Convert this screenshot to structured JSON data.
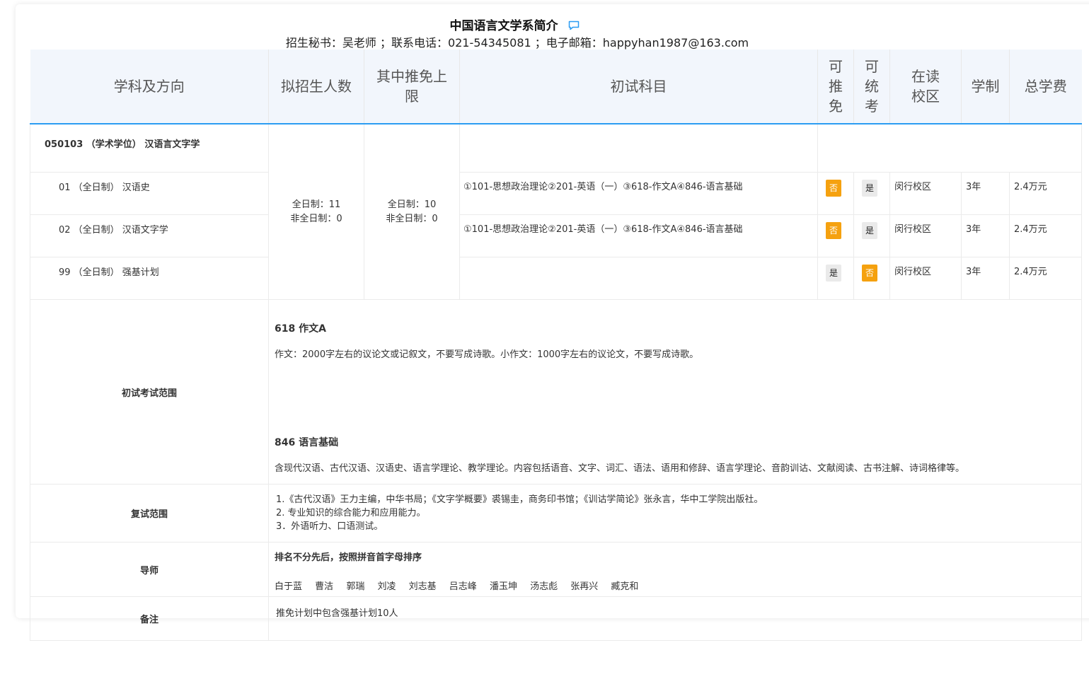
{
  "header": {
    "title": "中国语言文学系简介",
    "contact": "招生秘书：吴老师 ；联系电话：021-54345081 ；电子邮箱：happyhan1987@163.com"
  },
  "columns": [
    "学科及方向",
    "拟招生人数",
    "其中推免上限",
    "初试科目",
    "可推免",
    "可统考",
    "在读校区",
    "学制",
    "总学费"
  ],
  "program": {
    "name": "050103 （学术学位） 汉语言文字学",
    "enroll": "全日制：11 非全日制：0",
    "enroll_full": "全日制：11",
    "enroll_part": "非全日制：0",
    "exempt_full": "全日制：10",
    "exempt_part": "非全日制：0",
    "directions": [
      {
        "name": "01 （全日制） 汉语史",
        "subjects": "①101-思想政治理论②201-英语（一）③618-作文A④846-语言基础",
        "recommend": "否",
        "unified": "是",
        "campus": "闵行校区",
        "duration": "3年",
        "fee": "2.4万元"
      },
      {
        "name": "02 （全日制） 汉语文字学",
        "subjects": "①101-思想政治理论②201-英语（一）③618-作文A④846-语言基础",
        "recommend": "否",
        "unified": "是",
        "campus": "闵行校区",
        "duration": "3年",
        "fee": "2.4万元"
      },
      {
        "name": "99 （全日制） 强基计划",
        "subjects": "",
        "recommend": "是",
        "unified": "否",
        "campus": "闵行校区",
        "duration": "3年",
        "fee": "2.4万元"
      }
    ]
  },
  "exam_scope": {
    "label": "初试考试范围",
    "items": [
      {
        "title": "618 作文A",
        "desc": "作文：2000字左右的议论文或记叙文，不要写成诗歌。小作文：1000字左右的议论文，不要写成诗歌。"
      },
      {
        "title": "846 语言基础",
        "desc": "含现代汉语、古代汉语、汉语史、语言学理论、教学理论。内容包括语音、文字、词汇、语法、语用和修辞、语言学理论、音韵训诂、文献阅读、古书注解、诗词格律等。"
      }
    ]
  },
  "retest": {
    "label": "复试范围",
    "lines": [
      "1.《古代汉语》王力主编，中华书局；《文字学概要》裘锡圭，商务印书馆；《训诂学简论》张永言，华中工学院出版社。",
      "2. 专业知识的综合能力和应用能力。",
      "3．外语听力、口语测试。"
    ]
  },
  "tutors": {
    "label": "导师",
    "note": "排名不分先后，按照拼音首字母排序",
    "names": [
      "白于蓝",
      "曹洁",
      "郭瑞",
      "刘凌",
      "刘志基",
      "吕志峰",
      "潘玉坤",
      "汤志彪",
      "张再兴",
      "臧克和"
    ]
  },
  "remark": {
    "label": "备注",
    "text": "推免计划中包含强基计划10人"
  },
  "colors": {
    "accent_blue": "#2b9cf2",
    "tag_no": "#f5a10f",
    "tag_yes": "#eaeaea",
    "header_bg": "#f2f6fc"
  }
}
